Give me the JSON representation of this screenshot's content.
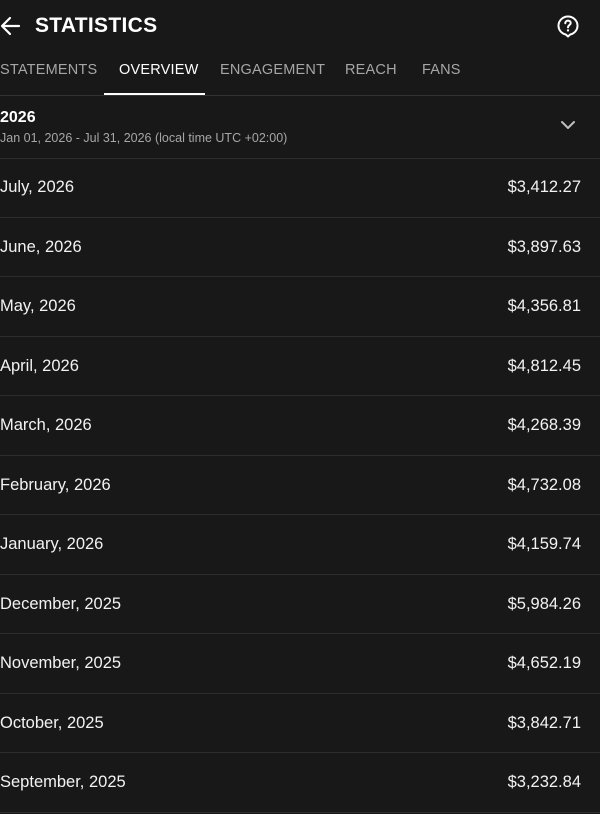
{
  "header": {
    "title": "STATISTICS",
    "back_icon": "arrow-left-icon",
    "help_icon": "question-circle-icon"
  },
  "tabs": [
    {
      "label": "STATEMENTS",
      "active": false
    },
    {
      "label": "OVERVIEW",
      "active": true
    },
    {
      "label": "ENGAGEMENT",
      "active": false
    },
    {
      "label": "REACH",
      "active": false
    },
    {
      "label": "FANS",
      "active": false
    }
  ],
  "period": {
    "year": "2026",
    "range": "Jan 01, 2026 - Jul 31, 2026 (local time UTC +02:00)",
    "chevron_icon": "chevron-down-icon"
  },
  "months": [
    {
      "label": "July, 2026",
      "amount": "$3,412.27"
    },
    {
      "label": "June, 2026",
      "amount": "$3,897.63"
    },
    {
      "label": "May, 2026",
      "amount": "$4,356.81"
    },
    {
      "label": "April, 2026",
      "amount": "$4,812.45"
    },
    {
      "label": "March, 2026",
      "amount": "$4,268.39"
    },
    {
      "label": "February, 2026",
      "amount": "$4,732.08"
    },
    {
      "label": "January, 2026",
      "amount": "$4,159.74"
    },
    {
      "label": "December, 2025",
      "amount": "$5,984.26"
    },
    {
      "label": "November, 2025",
      "amount": "$4,652.19"
    },
    {
      "label": "October, 2025",
      "amount": "$3,842.71"
    },
    {
      "label": "September, 2025",
      "amount": "$3,232.84"
    }
  ],
  "colors": {
    "background": "#181818",
    "text_primary": "#ffffff",
    "text_secondary": "#a6a6a6",
    "divider": "#2c2c2c"
  }
}
